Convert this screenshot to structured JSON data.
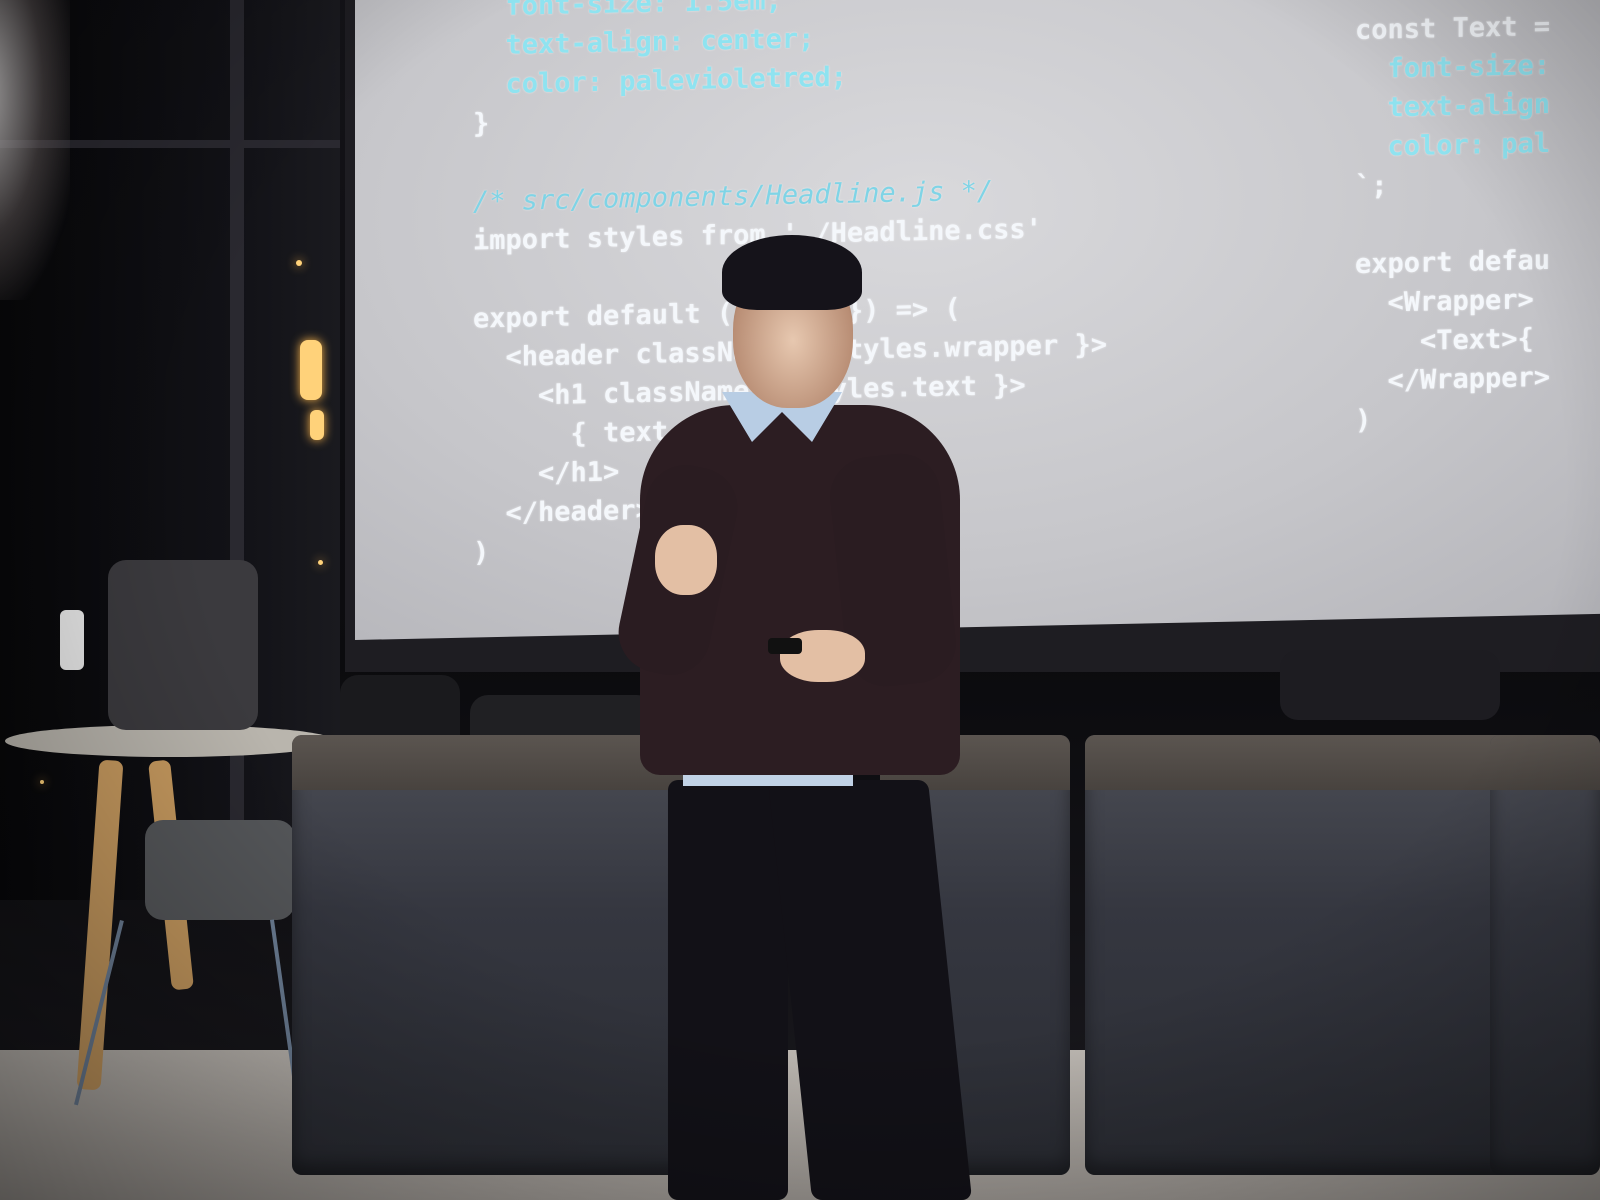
{
  "screen": {
    "left_code": {
      "line1": "  font-size: 1.5em;",
      "line2": "  text-align: center;",
      "line3": "  color: palevioletred;",
      "line4": "}",
      "line5": "/* src/components/Headline.js */",
      "line6": "import styles from './Headline.css'",
      "line7": "export default ({ text }) => (",
      "line8": "  <header className={ styles.wrapper }>",
      "line9": "    <h1 className={ styles.text }>",
      "line10": "      { text }",
      "line11": "    </h1>",
      "line12": "  </header>",
      "line13": ")"
    },
    "right_code": {
      "line1": "const Text =",
      "line2": "  font-size:",
      "line3": "  text-align",
      "line4": "  color: pal",
      "line5": "`;",
      "line6": "export defau",
      "line7": "  <Wrapper>",
      "line8": "    <Text>{",
      "line9": "  </Wrapper>",
      "line10": ")"
    }
  },
  "colors": {
    "screen": "#d0d0d4",
    "code_text": "#f4f7fb",
    "css_property": "#8fe3f0",
    "sweater": "#2c1d22",
    "bench": "#353740"
  }
}
